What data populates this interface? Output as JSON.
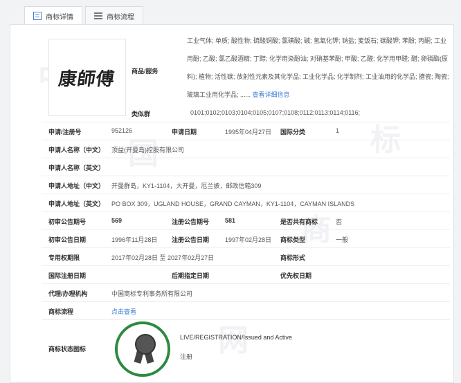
{
  "tabs": [
    {
      "label": "商标详情",
      "active": true
    },
    {
      "label": "商标流程",
      "active": false
    }
  ],
  "logo": {
    "text": "康師傅"
  },
  "goods": {
    "label": "商品/服务",
    "text": "工业气体; 单质; 酸性物; 硫酸铜酸; 氯磺酸; 碱; 氢氧化钾; 钠盐; 麦饭石; 碳酸钾; 苯酚; 丙酮; 工业用酚; 乙酸; 氯乙酸酒精; 丁醇; 化学用染酚油; 对硝基苯酚; 甲酸; 乙醛; 化学用甲醛; 醋; 卵磷酯(原料); 植物; 活性碳; 放射性元素及其化学品; 工业化学品; 化学制剂; 工业油用的化学品; 搪瓷; 陶瓷; 玻璃工业用化学品; ......",
    "more_link": "查看详细信息"
  },
  "class_group": {
    "label": "类似群",
    "value": "0101;0102;0103;0104;0105;0107;0108;0112;0113;0114;0116;"
  },
  "fields": {
    "reg_no_label": "申请/注册号",
    "reg_no": "952126",
    "app_date_label": "申请日期",
    "app_date": "1995年04月27日",
    "intl_class_label": "国际分类",
    "intl_class": "1",
    "name_cn_label": "申请人名称（中文）",
    "name_cn": "顶益(开曼岛)控股有限公司",
    "name_en_label": "申请人名称（英文）",
    "name_en": "",
    "addr_cn_label": "申请人地址（中文）",
    "addr_cn": "开曼群岛，KY1-1104，大开曼，厄兰披，邮政信箱309",
    "addr_en_label": "申请人地址（英文）",
    "addr_en": "PO BOX 309，UGLAND HOUSE，GRAND CAYMAN，KY1-1104，CAYMAN ISLANDS",
    "prelim_no_label": "初审公告期号",
    "prelim_no": "569",
    "reg_pub_no_label": "注册公告期号",
    "reg_pub_no": "581",
    "shared_label": "是否共有商标",
    "shared": "否",
    "prelim_date_label": "初审公告日期",
    "prelim_date": "1996年11月28日",
    "reg_pub_date_label": "注册公告日期",
    "reg_pub_date": "1997年02月28日",
    "tm_type_label": "商标类型",
    "tm_type": "一般",
    "exclusive_label": "专用权期限",
    "exclusive": "2017年02月28日 至 2027年02月27日",
    "tm_form_label": "商标形式",
    "tm_form": "",
    "intl_reg_label": "国际注册日期",
    "intl_reg": "",
    "later_label": "后期指定日期",
    "later": "",
    "priority_label": "优先权日期",
    "priority": "",
    "agent_label": "代理/办理机构",
    "agent": "中国商标专利事务所有限公司",
    "process_label": "商标流程",
    "process_link": "点击查看",
    "status_label": "商标状态图标",
    "status_text": "LIVE/REGISTRATION/Issued and Active",
    "status_sub": "注册"
  },
  "watermark": [
    "中",
    "国",
    "商",
    "标",
    "网"
  ]
}
